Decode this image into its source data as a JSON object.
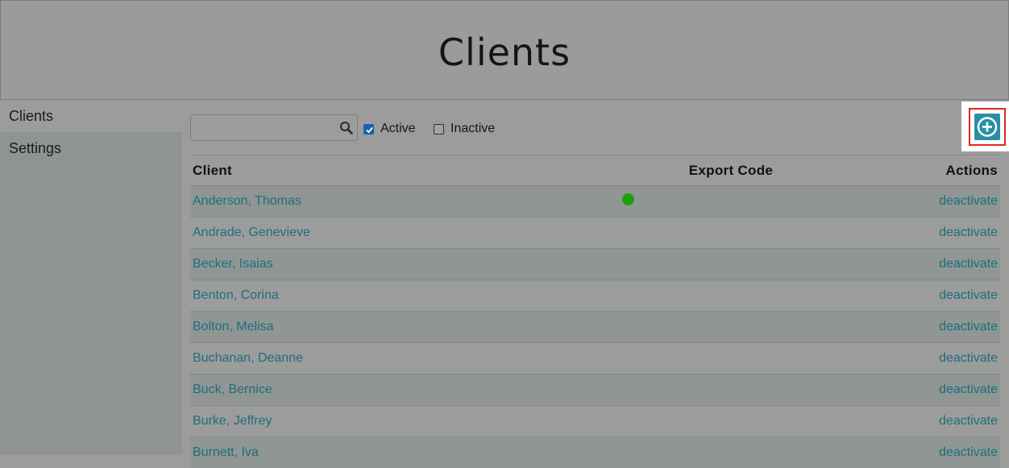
{
  "header": {
    "title": "Clients"
  },
  "sidebar": {
    "items": [
      {
        "label": "Clients",
        "active": true
      },
      {
        "label": "Settings",
        "active": false
      }
    ]
  },
  "toolbar": {
    "search": {
      "value": "",
      "placeholder": "",
      "icon": "search-icon"
    },
    "filters": {
      "active": {
        "label": "Active",
        "checked": true
      },
      "inactive": {
        "label": "Inactive",
        "checked": false
      }
    },
    "add_button": {
      "icon": "plus-circle-icon",
      "color": "#2a8fa5",
      "highlight": "#e0281c"
    }
  },
  "table": {
    "headers": {
      "client": "Client",
      "export_code": "Export Code",
      "actions": "Actions"
    },
    "rows": [
      {
        "client": "Anderson, Thomas",
        "status_dot": "#1f9e0e",
        "action": "deactivate"
      },
      {
        "client": "Andrade, Genevieve",
        "action": "deactivate"
      },
      {
        "client": "Becker, Isaias",
        "action": "deactivate"
      },
      {
        "client": "Benton, Corina",
        "action": "deactivate"
      },
      {
        "client": "Bolton, Melisa",
        "action": "deactivate"
      },
      {
        "client": "Buchanan, Deanne",
        "action": "deactivate"
      },
      {
        "client": "Buck, Bernice",
        "action": "deactivate"
      },
      {
        "client": "Burke, Jeffrey",
        "action": "deactivate"
      },
      {
        "client": "Burnett, Iva",
        "action": "deactivate"
      }
    ]
  }
}
